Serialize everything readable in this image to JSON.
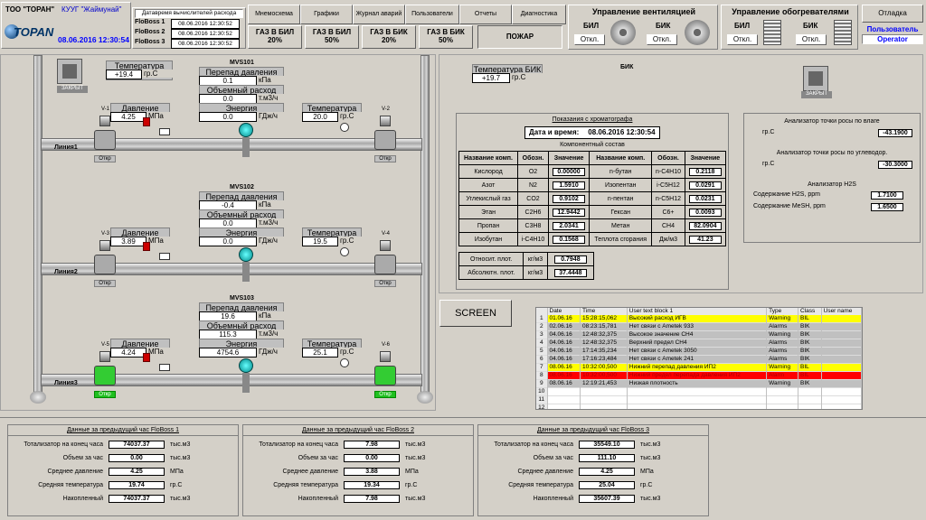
{
  "company": "ТОО \"TOPAH\"",
  "customer": "КУУГ \"Жаймунай\"",
  "logo": "TOPAN",
  "datetime": "08.06.2016 12:30:54",
  "calc_header": "Датавремя вычислителей расхода",
  "floboss": [
    {
      "name": "FloBoss 1",
      "time": "08.06.2016 12:30:52"
    },
    {
      "name": "FloBoss 2",
      "time": "08.06.2016 12:30:52"
    },
    {
      "name": "FloBoss 3",
      "time": "08.06.2016 12:30:52"
    }
  ],
  "nav": [
    "Мнемосхема",
    "Графики",
    "Журнал аварий",
    "Пользователи",
    "Отчеты",
    "Диагностика"
  ],
  "gas": [
    {
      "label": "ГАЗ В БИЛ",
      "pct": "20%"
    },
    {
      "label": "ГАЗ В БИЛ",
      "pct": "50%"
    },
    {
      "label": "ГАЗ В БИК",
      "pct": "20%"
    },
    {
      "label": "ГАЗ В БИК",
      "pct": "50%"
    }
  ],
  "fire": "ПОЖАР",
  "vent": {
    "title": "Управление вентиляцией",
    "bil": "БИЛ",
    "bik": "БИК",
    "off": "Откл."
  },
  "heat": {
    "title": "Управление обогревателями",
    "bil": "БИЛ",
    "bik": "БИК",
    "off": "Откл."
  },
  "right": {
    "debug": "Отладка",
    "user_label": "Пользователь",
    "user": "Operator"
  },
  "left": {
    "door": "ЗАКРЫТ",
    "temp_bil_label": "Температура БИЛ",
    "temp_bil": "+19.4",
    "temp_unit": "гр.С",
    "lines": [
      {
        "name": "Линия1",
        "mvs": "MVS101",
        "dp": "0.1",
        "dp_u": "кПа",
        "flow": "0.0",
        "flow_u": "т.м3/ч",
        "energy": "0.0",
        "energy_u": "ГДж/ч",
        "press": "4.25",
        "press_u": "МПа",
        "temp": "20.0",
        "temp_u": "гр.С",
        "va": "V-1",
        "vb": "V-2",
        "sa": "Откр",
        "sb": "Откр"
      },
      {
        "name": "Линия2",
        "mvs": "MVS102",
        "dp": "-0.4",
        "dp_u": "кПа",
        "flow": "0.0",
        "flow_u": "т.м3/ч",
        "energy": "0.0",
        "energy_u": "ГДж/ч",
        "press": "3.89",
        "press_u": "МПа",
        "temp": "19.5",
        "temp_u": "гр.С",
        "va": "V-3",
        "vb": "V-4",
        "sa": "Откр",
        "sb": "Откр"
      },
      {
        "name": "Линия3",
        "mvs": "MVS103",
        "dp": "19.6",
        "dp_u": "кПа",
        "flow": "115.3",
        "flow_u": "т.м3/ч",
        "energy": "4754.6",
        "energy_u": "ГДж/ч",
        "press": "4.24",
        "press_u": "МПа",
        "temp": "25.1",
        "temp_u": "гр.С",
        "va": "V-5",
        "vb": "V-6",
        "sa": "Откр",
        "sb": "Откр"
      }
    ],
    "dp_label": "Перепад давления",
    "flow_label": "Объемный расход",
    "energy_label": "Энергия",
    "press_label": "Давление",
    "temp_label": "Температура"
  },
  "bik": {
    "title": "БИК",
    "temp_label": "Температура БИК",
    "temp": "+19.7",
    "temp_unit": "гр.С",
    "door": "ЗАКРЫТ"
  },
  "chrom": {
    "title": "Показания с хроматографа",
    "dt_label": "Дата и время:",
    "dt": "08.06.2016 12:30:54",
    "comp": "Компонентный состав",
    "head": [
      "Название комп.",
      "Обозн.",
      "Значение",
      "Название комп.",
      "Обозн.",
      "Значение"
    ],
    "rows": [
      [
        "Кислород",
        "O2",
        "0.00000",
        "n-бутан",
        "n-C4H10",
        "0.2118"
      ],
      [
        "Азот",
        "N2",
        "1.5910",
        "Изопентан",
        "i-C5H12",
        "0.0291"
      ],
      [
        "Углекислый газ",
        "CO2",
        "0.9102",
        "n-пентан",
        "n-C5H12",
        "0.0231"
      ],
      [
        "Этан",
        "C2H6",
        "12.9442",
        "Гексан",
        "C6+",
        "0.0093"
      ],
      [
        "Пропан",
        "C3H8",
        "2.0341",
        "Метан",
        "CH4",
        "82.0904"
      ],
      [
        "Изобутан",
        "i-C4H10",
        "0.1568",
        "Теплота сгорания",
        "Дж/м3",
        "41.23"
      ]
    ],
    "dens": [
      [
        "Относит. плот.",
        "кг/м3",
        "0.7948"
      ],
      [
        "Абсолютн. плот.",
        "кг/м3",
        "37.4448"
      ]
    ]
  },
  "dew": {
    "moist_title": "Анализатор точки росы по влаге",
    "unit": "гр.С",
    "moist": "-43.1900",
    "hc_title": "Анализатор точки росы по углеводор.",
    "hc": "-30.3000",
    "h2s_title": "Анализатор H2S",
    "h2s_label": "Содержание H2S, ppm",
    "h2s": "1.7100",
    "mesh_label": "Содержание MeSH, ppm",
    "mesh": "1.6500"
  },
  "screen": "SCREEN",
  "alarms": {
    "cols": [
      "Date",
      "Time",
      "User text block 1",
      "Type",
      "Class",
      "User name"
    ],
    "rows": [
      [
        "1",
        "01.06.16",
        "15:28:15,062",
        "Высокий расход ИГВ",
        "Warning",
        "BIL",
        "",
        ""
      ],
      [
        "2",
        "02.06.16",
        "08:23:15,781",
        "Нет связи с Ametek 933",
        "Alarms",
        "BIK",
        "",
        ""
      ],
      [
        "3",
        "04.06.16",
        "12:48:32,375",
        "Высокое значение CH4",
        "Warning",
        "BIK",
        "",
        ""
      ],
      [
        "4",
        "04.06.16",
        "12:48:32,375",
        "Верхний предел CH4",
        "Alarms",
        "BIK",
        "",
        ""
      ],
      [
        "5",
        "04.06.16",
        "17:14:35,234",
        "Нет связи с Ametek 3050",
        "Alarms",
        "BIK",
        "",
        ""
      ],
      [
        "6",
        "04.06.16",
        "17:16:23,484",
        "Нет связи с Ametek 241",
        "Alarms",
        "BIK",
        "",
        ""
      ],
      [
        "7",
        "08.06.16",
        "10:32:00,500",
        "Нижний перепад давления ИП2",
        "Warning",
        "BIL",
        "",
        ""
      ],
      [
        "8",
        "08.06.16",
        "10:32:00,500",
        "Нижний предел перепада давления ИП2",
        "Alarm",
        "BIL",
        "",
        ""
      ],
      [
        "9",
        "08.06.16",
        "12:19:21,453",
        "Низкая плотность",
        "Warning",
        "BIK",
        "",
        ""
      ],
      [
        "10",
        "",
        "",
        "",
        "",
        "",
        "",
        ""
      ],
      [
        "11",
        "",
        "",
        "",
        "",
        "",
        "",
        ""
      ],
      [
        "12",
        "",
        "",
        "",
        "",
        "",
        "",
        ""
      ],
      [
        "13",
        "",
        "",
        "",
        "",
        "",
        "",
        ""
      ]
    ]
  },
  "hist": [
    {
      "title": "Данные за предыдущий час  FloBoss 1",
      "rows": [
        [
          "Тотализатор на конец часа",
          "74037.37",
          "тыс.м3"
        ],
        [
          "Объем за час",
          "0.00",
          "тыс.м3"
        ],
        [
          "Среднее давление",
          "4.25",
          "МПа"
        ],
        [
          "Средняя температура",
          "19.74",
          "гр.С"
        ],
        [
          "Накопленный",
          "74037.37",
          "тыс.м3"
        ]
      ]
    },
    {
      "title": "Данные за предыдущий час  FloBoss 2",
      "rows": [
        [
          "Тотализатор на конец часа",
          "7.98",
          "тыс.м3"
        ],
        [
          "Объем за час",
          "0.00",
          "тыс.м3"
        ],
        [
          "Среднее давление",
          "3.88",
          "МПа"
        ],
        [
          "Средняя температура",
          "19.34",
          "гр.С"
        ],
        [
          "Накопленный",
          "7.98",
          "тыс.м3"
        ]
      ]
    },
    {
      "title": "Данные за предыдущий час  FloBoss 3",
      "rows": [
        [
          "Тотализатор на конец часа",
          "35549.10",
          "тыс.м3"
        ],
        [
          "Объем за час",
          "111.10",
          "тыс.м3"
        ],
        [
          "Среднее давление",
          "4.25",
          "МПа"
        ],
        [
          "Средняя температура",
          "25.04",
          "гр.С"
        ],
        [
          "Накопленный",
          "35607.39",
          "тыс.м3"
        ]
      ]
    }
  ],
  "colors": {
    "yellow": "#ffff00",
    "red": "#ff0000",
    "green": "#20c020",
    "blue": "#0000ff"
  }
}
